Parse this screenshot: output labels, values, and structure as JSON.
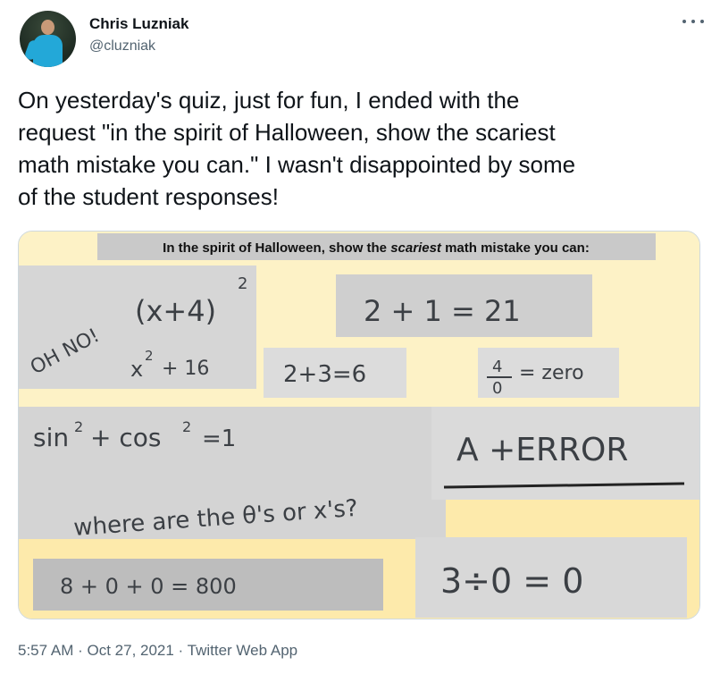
{
  "author": {
    "name": "Chris Luzniak",
    "handle": "@cluzniak"
  },
  "more_icon": "more-horizontal-icon",
  "tweet_text": "On yesterday's quiz, just for fun, I ended with the\nrequest \"in the spirit of Halloween, show the scariest\nmath mistake you can.\" I wasn't disappointed by some\nof the student responses!",
  "image": {
    "prompt_before": "In the spirit of Halloween, show the ",
    "prompt_emphasis": "scariest",
    "prompt_after": " math mistake you can:",
    "cards": {
      "oh_no": "OH NO!",
      "binomial": "(x+4)",
      "binomial_exp": "2",
      "expansion": "x",
      "expansion_exp": "2",
      "expansion_rest": "+ 16",
      "two_plus_one": "2 + 1 = 21",
      "two_plus_three": "2+3=6",
      "frac_num": "4",
      "frac_den": "0",
      "frac_rest": "= zero",
      "trig_sin": "sin",
      "trig_cos": "+ cos",
      "trig_exp": "2",
      "trig_rest": "=1",
      "trig_question": "where are the θ's or x's?",
      "a_error": "A  +ERROR",
      "eight_hundred": "8 + 0 + 0 = 800",
      "three_div_zero": "3÷0 = 0"
    },
    "background_color": "#fdf2c6",
    "paper_color": "#d3d3d3"
  },
  "footer": {
    "time": "5:57 AM",
    "separator": " · ",
    "date": "Oct 27, 2021",
    "source": "Twitter Web App"
  }
}
